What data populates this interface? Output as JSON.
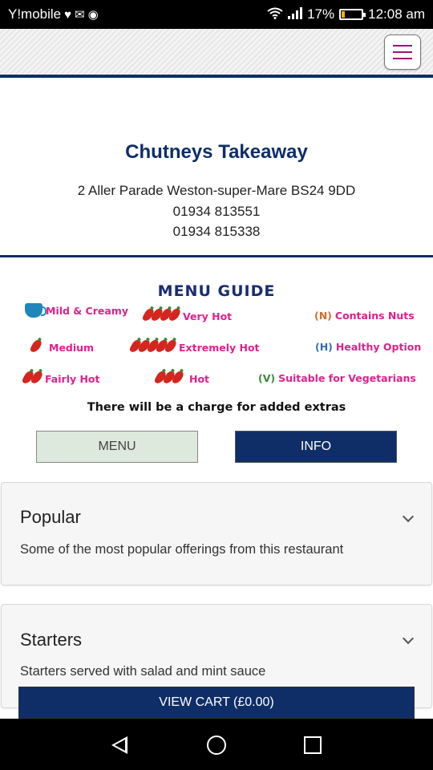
{
  "status_bar": {
    "carrier": "Y!mobile",
    "icons": [
      "heart-pulse-icon",
      "mail-icon",
      "basketball-icon"
    ],
    "wifi": "wifi-icon",
    "signal": "signal-icon",
    "battery_percent": "17%",
    "battery_level": 0.17,
    "time": "12:08 am"
  },
  "header": {
    "menu_icon": "hamburger-menu-icon"
  },
  "restaurant": {
    "name": "Chutneys Takeaway",
    "address": "2 Aller Parade  Weston-super-Mare BS24 9DD",
    "phone1": "01934 813551",
    "phone2": "01934 815338"
  },
  "menu_guide": {
    "title": "MENU GUIDE",
    "mild": "Mild & Creamy",
    "very_hot": "Very Hot",
    "nuts_code": "(N)",
    "nuts": "Contains Nuts",
    "medium": "Medium",
    "extremely_hot": "Extremely Hot",
    "healthy_code": "(H)",
    "healthy": "Healthy Option",
    "fairly_hot": "Fairly Hot",
    "hot": "Hot",
    "veg_code": "(V)",
    "veg": "Suitable for Vegetarians",
    "charge_note": "There will be a charge for added extras",
    "colors": {
      "pink": "#e0208c",
      "navy": "#0f2e68",
      "chili": "#d4261f"
    }
  },
  "buttons": {
    "menu": "MENU",
    "info": "INFO"
  },
  "sections": [
    {
      "title": "Popular",
      "description": "Some of the most popular offerings from this restaurant"
    },
    {
      "title": "Starters",
      "description": "Starters served with salad and mint sauce"
    }
  ],
  "cart": {
    "label": "VIEW CART (£0.00)"
  },
  "nav_bar": {
    "icons": [
      "back-icon",
      "home-icon",
      "recent-apps-icon"
    ]
  }
}
